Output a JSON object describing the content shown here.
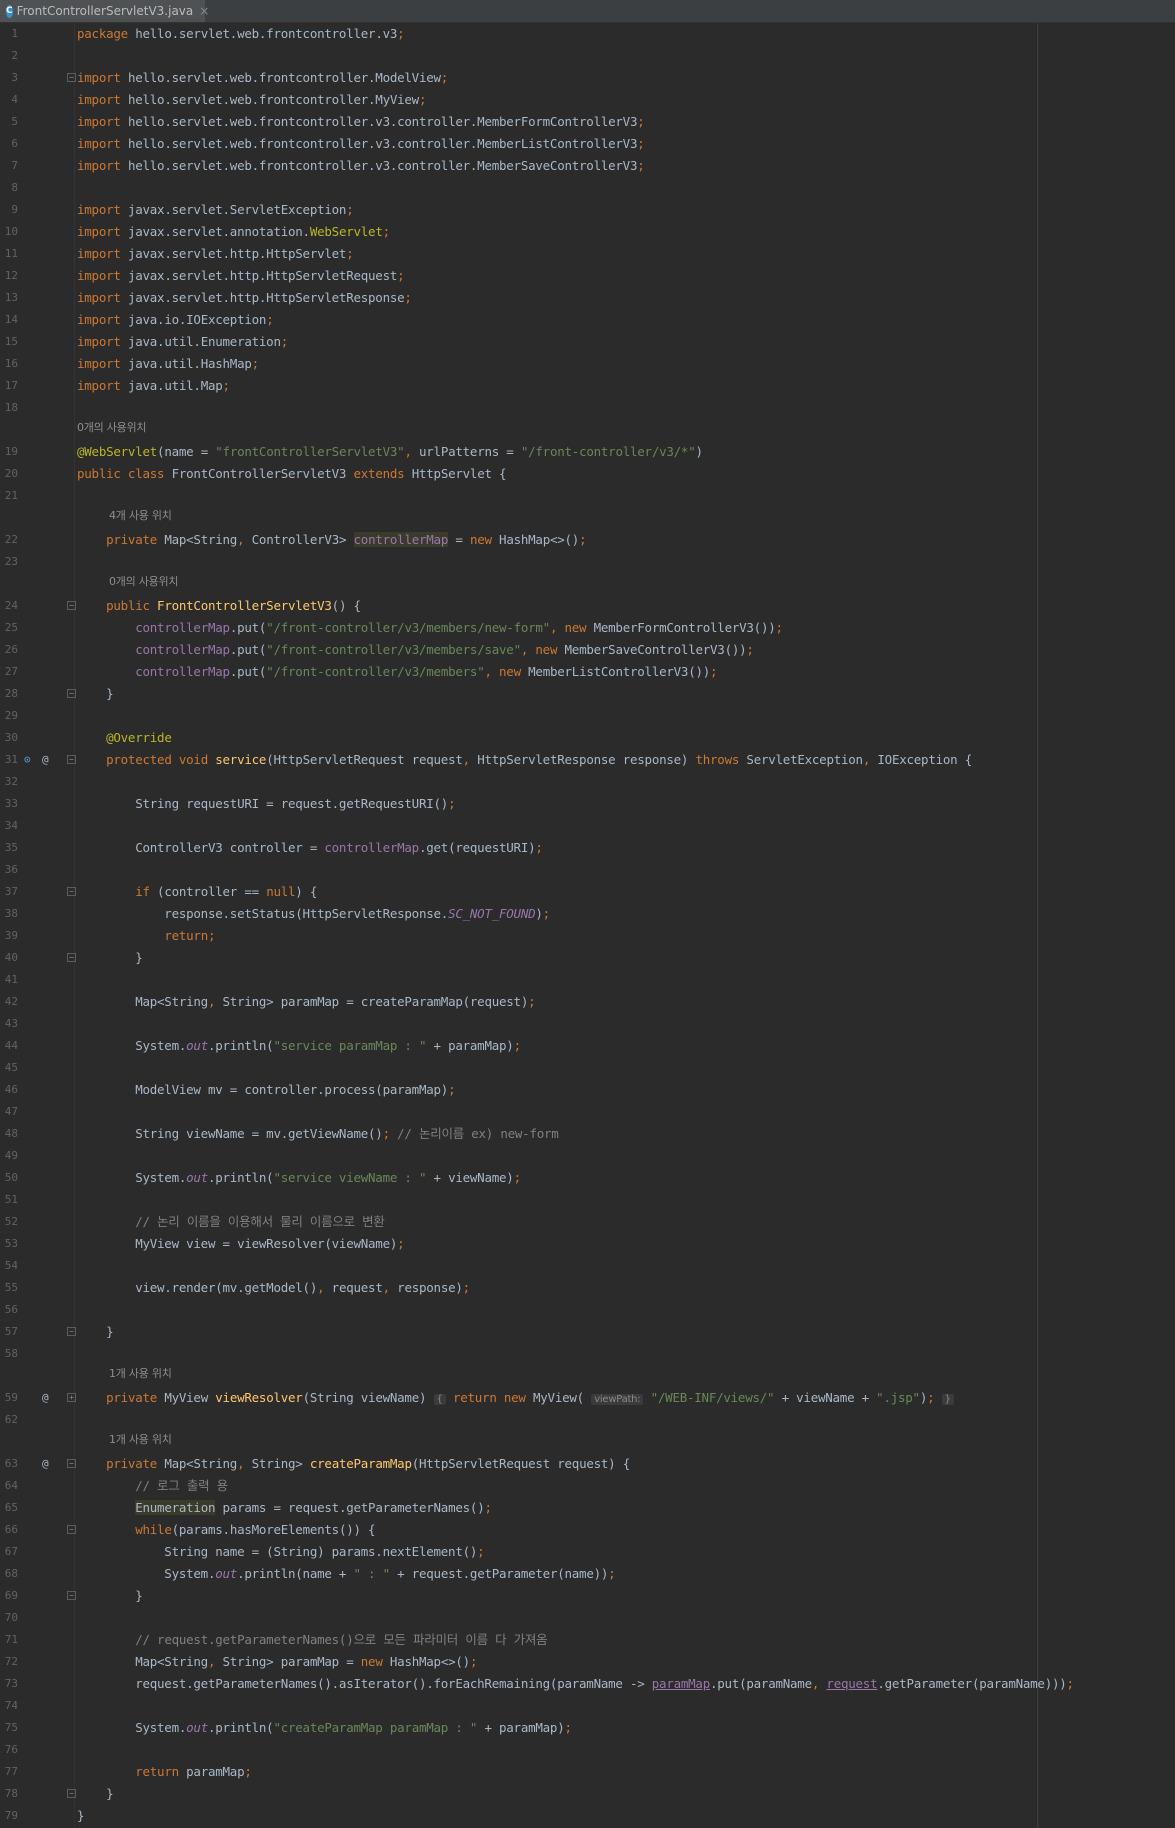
{
  "tab": {
    "label": "FrontControllerServletV3.java",
    "icon": "java-class-icon",
    "close": "×"
  },
  "lines": [
    {
      "n": "1",
      "tokens": [
        [
          "kw",
          "package "
        ],
        [
          "",
          "hello.servlet.web.frontcontroller.v3"
        ],
        [
          "kw",
          ";"
        ]
      ]
    },
    {
      "n": "2",
      "tokens": []
    },
    {
      "n": "3",
      "tokens": [
        [
          "kw",
          "import "
        ],
        [
          "",
          "hello.servlet.web.frontcontroller.ModelView"
        ],
        [
          "kw",
          ";"
        ]
      ]
    },
    {
      "n": "4",
      "tokens": [
        [
          "kw",
          "import "
        ],
        [
          "",
          "hello.servlet.web.frontcontroller.MyView"
        ],
        [
          "kw",
          ";"
        ]
      ]
    },
    {
      "n": "5",
      "tokens": [
        [
          "kw",
          "import "
        ],
        [
          "",
          "hello.servlet.web.frontcontroller.v3.controller.MemberFormControllerV3"
        ],
        [
          "kw",
          ";"
        ]
      ]
    },
    {
      "n": "6",
      "tokens": [
        [
          "kw",
          "import "
        ],
        [
          "",
          "hello.servlet.web.frontcontroller.v3.controller.MemberListControllerV3"
        ],
        [
          "kw",
          ";"
        ]
      ]
    },
    {
      "n": "7",
      "tokens": [
        [
          "kw",
          "import "
        ],
        [
          "",
          "hello.servlet.web.frontcontroller.v3.controller.MemberSaveControllerV3"
        ],
        [
          "kw",
          ";"
        ]
      ]
    },
    {
      "n": "8",
      "tokens": []
    },
    {
      "n": "9",
      "tokens": [
        [
          "kw",
          "import "
        ],
        [
          "",
          "javax.servlet.ServletException"
        ],
        [
          "kw",
          ";"
        ]
      ]
    },
    {
      "n": "10",
      "tokens": [
        [
          "kw",
          "import "
        ],
        [
          "",
          "javax.servlet.annotation."
        ],
        [
          "ann",
          "WebServlet"
        ],
        [
          "kw",
          ";"
        ]
      ]
    },
    {
      "n": "11",
      "tokens": [
        [
          "kw",
          "import "
        ],
        [
          "",
          "javax.servlet.http.HttpServlet"
        ],
        [
          "kw",
          ";"
        ]
      ]
    },
    {
      "n": "12",
      "tokens": [
        [
          "kw",
          "import "
        ],
        [
          "",
          "javax.servlet.http.HttpServletRequest"
        ],
        [
          "kw",
          ";"
        ]
      ]
    },
    {
      "n": "13",
      "tokens": [
        [
          "kw",
          "import "
        ],
        [
          "",
          "javax.servlet.http.HttpServletResponse"
        ],
        [
          "kw",
          ";"
        ]
      ]
    },
    {
      "n": "14",
      "tokens": [
        [
          "kw",
          "import "
        ],
        [
          "",
          "java.io.IOException"
        ],
        [
          "kw",
          ";"
        ]
      ]
    },
    {
      "n": "15",
      "tokens": [
        [
          "kw",
          "import "
        ],
        [
          "",
          "java.util.Enumeration"
        ],
        [
          "kw",
          ";"
        ]
      ]
    },
    {
      "n": "16",
      "tokens": [
        [
          "kw",
          "import "
        ],
        [
          "",
          "java.util.HashMap"
        ],
        [
          "kw",
          ";"
        ]
      ]
    },
    {
      "n": "17",
      "tokens": [
        [
          "kw",
          "import "
        ],
        [
          "",
          "java.util.Map"
        ],
        [
          "kw",
          ";"
        ]
      ]
    },
    {
      "n": "18",
      "tokens": []
    },
    {
      "n": "",
      "hint": "0개의 사용위치"
    },
    {
      "n": "19",
      "tokens": [
        [
          "ann",
          "@WebServlet"
        ],
        [
          "",
          "(name = "
        ],
        [
          "str",
          "\"frontControllerServletV3\""
        ],
        [
          "kw",
          ", "
        ],
        [
          "",
          "urlPatterns = "
        ],
        [
          "str",
          "\"/front-controller/v3/*\""
        ],
        [
          "",
          ")"
        ]
      ]
    },
    {
      "n": "20",
      "tokens": [
        [
          "kw",
          "public class "
        ],
        [
          "",
          "FrontControllerServletV3 "
        ],
        [
          "kw",
          "extends "
        ],
        [
          "",
          "HttpServlet {"
        ]
      ]
    },
    {
      "n": "21",
      "tokens": []
    },
    {
      "n": "",
      "hint": "4개 사용 위치",
      "indent": 1
    },
    {
      "n": "22",
      "tokens": [
        [
          "",
          "    "
        ],
        [
          "kw",
          "private "
        ],
        [
          "",
          "Map<String"
        ],
        [
          "kw",
          ", "
        ],
        [
          "",
          "ControllerV3> "
        ],
        [
          "fld hl",
          "controllerMap"
        ],
        [
          "",
          " = "
        ],
        [
          "kw",
          "new "
        ],
        [
          "",
          "HashMap<>()"
        ],
        [
          "kw",
          ";"
        ]
      ]
    },
    {
      "n": "23",
      "tokens": []
    },
    {
      "n": "",
      "hint": "0개의 사용위치",
      "indent": 1
    },
    {
      "n": "24",
      "tokens": [
        [
          "",
          "    "
        ],
        [
          "kw",
          "public "
        ],
        [
          "fn",
          "FrontControllerServletV3"
        ],
        [
          "",
          "() {"
        ]
      ]
    },
    {
      "n": "25",
      "tokens": [
        [
          "",
          "        "
        ],
        [
          "fld",
          "controllerMap"
        ],
        [
          "",
          ".put("
        ],
        [
          "str",
          "\"/front-controller/v3/members/new-form\""
        ],
        [
          "kw",
          ", new "
        ],
        [
          "",
          "MemberFormControllerV3())"
        ],
        [
          "kw",
          ";"
        ]
      ]
    },
    {
      "n": "26",
      "tokens": [
        [
          "",
          "        "
        ],
        [
          "fld",
          "controllerMap"
        ],
        [
          "",
          ".put("
        ],
        [
          "str",
          "\"/front-controller/v3/members/save\""
        ],
        [
          "kw",
          ", new "
        ],
        [
          "",
          "MemberSaveControllerV3())"
        ],
        [
          "kw",
          ";"
        ]
      ]
    },
    {
      "n": "27",
      "tokens": [
        [
          "",
          "        "
        ],
        [
          "fld",
          "controllerMap"
        ],
        [
          "",
          ".put("
        ],
        [
          "str",
          "\"/front-controller/v3/members\""
        ],
        [
          "kw",
          ", new "
        ],
        [
          "",
          "MemberListControllerV3())"
        ],
        [
          "kw",
          ";"
        ]
      ]
    },
    {
      "n": "28",
      "tokens": [
        [
          "",
          "    }"
        ]
      ]
    },
    {
      "n": "29",
      "tokens": []
    },
    {
      "n": "30",
      "tokens": [
        [
          "",
          "    "
        ],
        [
          "ann",
          "@Override"
        ]
      ]
    },
    {
      "n": "31",
      "tokens": [
        [
          "",
          "    "
        ],
        [
          "kw",
          "protected void "
        ],
        [
          "fn",
          "service"
        ],
        [
          "",
          "(HttpServletRequest request"
        ],
        [
          "kw",
          ", "
        ],
        [
          "",
          "HttpServletResponse response) "
        ],
        [
          "kw",
          "throws "
        ],
        [
          "",
          "ServletException"
        ],
        [
          "kw",
          ", "
        ],
        [
          "",
          "IOException {"
        ]
      ]
    },
    {
      "n": "32",
      "tokens": []
    },
    {
      "n": "33",
      "tokens": [
        [
          "",
          "        String requestURI = request.getRequestURI()"
        ],
        [
          "kw",
          ";"
        ]
      ]
    },
    {
      "n": "34",
      "tokens": []
    },
    {
      "n": "35",
      "tokens": [
        [
          "",
          "        ControllerV3 controller = "
        ],
        [
          "fld",
          "controllerMap"
        ],
        [
          "",
          ".get(requestURI)"
        ],
        [
          "kw",
          ";"
        ]
      ]
    },
    {
      "n": "36",
      "tokens": []
    },
    {
      "n": "37",
      "tokens": [
        [
          "",
          "        "
        ],
        [
          "kw",
          "if "
        ],
        [
          "",
          "(controller == "
        ],
        [
          "kw",
          "null"
        ],
        [
          "",
          ") {"
        ]
      ]
    },
    {
      "n": "38",
      "tokens": [
        [
          "",
          "            response.setStatus(HttpServletResponse."
        ],
        [
          "sf",
          "SC_NOT_FOUND"
        ],
        [
          "",
          ")"
        ],
        [
          "kw",
          ";"
        ]
      ]
    },
    {
      "n": "39",
      "tokens": [
        [
          "",
          "            "
        ],
        [
          "kw",
          "return;"
        ]
      ]
    },
    {
      "n": "40",
      "tokens": [
        [
          "",
          "        }"
        ]
      ]
    },
    {
      "n": "41",
      "tokens": []
    },
    {
      "n": "42",
      "tokens": [
        [
          "",
          "        Map<String"
        ],
        [
          "kw",
          ", "
        ],
        [
          "",
          "String> paramMap = createParamMap(request)"
        ],
        [
          "kw",
          ";"
        ]
      ]
    },
    {
      "n": "43",
      "tokens": []
    },
    {
      "n": "44",
      "tokens": [
        [
          "",
          "        System."
        ],
        [
          "sf",
          "out"
        ],
        [
          "",
          ".println("
        ],
        [
          "str",
          "\"service paramMap : \""
        ],
        [
          "",
          " + paramMap)"
        ],
        [
          "kw",
          ";"
        ]
      ]
    },
    {
      "n": "45",
      "tokens": []
    },
    {
      "n": "46",
      "tokens": [
        [
          "",
          "        ModelView mv = controller.process(paramMap)"
        ],
        [
          "kw",
          ";"
        ]
      ]
    },
    {
      "n": "47",
      "tokens": []
    },
    {
      "n": "48",
      "tokens": [
        [
          "",
          "        String viewName = mv.getViewName()"
        ],
        [
          "kw",
          "; "
        ],
        [
          "cmt",
          "// 논리이름 ex) new-form"
        ]
      ]
    },
    {
      "n": "49",
      "tokens": []
    },
    {
      "n": "50",
      "tokens": [
        [
          "",
          "        System."
        ],
        [
          "sf",
          "out"
        ],
        [
          "",
          ".println("
        ],
        [
          "str",
          "\"service viewName : \""
        ],
        [
          "",
          " + viewName)"
        ],
        [
          "kw",
          ";"
        ]
      ]
    },
    {
      "n": "51",
      "tokens": []
    },
    {
      "n": "52",
      "tokens": [
        [
          "",
          "        "
        ],
        [
          "cmt",
          "// 논리 이름을 이용해서 물리 이름으로 변환"
        ]
      ]
    },
    {
      "n": "53",
      "tokens": [
        [
          "",
          "        MyView view = viewResolver(viewName)"
        ],
        [
          "kw",
          ";"
        ]
      ]
    },
    {
      "n": "54",
      "tokens": []
    },
    {
      "n": "55",
      "tokens": [
        [
          "",
          "        view.render(mv.getModel()"
        ],
        [
          "kw",
          ", "
        ],
        [
          "",
          "request"
        ],
        [
          "kw",
          ", "
        ],
        [
          "",
          "response)"
        ],
        [
          "kw",
          ";"
        ]
      ]
    },
    {
      "n": "56",
      "tokens": []
    },
    {
      "n": "57",
      "tokens": [
        [
          "",
          "    }"
        ]
      ]
    },
    {
      "n": "58",
      "tokens": []
    },
    {
      "n": "",
      "hint": "1개 사용 위치",
      "indent": 1
    },
    {
      "n": "59",
      "tokens": [
        [
          "",
          "    "
        ],
        [
          "kw",
          "private "
        ],
        [
          "",
          "MyView "
        ],
        [
          "fn",
          "viewResolver"
        ],
        [
          "",
          "(String viewName) "
        ],
        [
          "inlay-b",
          "{"
        ],
        [
          "",
          " "
        ],
        [
          "kw",
          "return new "
        ],
        [
          "",
          "MyView( "
        ],
        [
          "inlay",
          "viewPath:"
        ],
        [
          "",
          " "
        ],
        [
          "str",
          "\"/WEB-INF/views/\""
        ],
        [
          "",
          " + viewName + "
        ],
        [
          "str",
          "\".jsp\""
        ],
        [
          "",
          ")"
        ],
        [
          "kw",
          ";"
        ],
        [
          "",
          " "
        ],
        [
          "inlay-b",
          "}"
        ]
      ]
    },
    {
      "n": "62",
      "tokens": []
    },
    {
      "n": "",
      "hint": "1개 사용 위치",
      "indent": 1
    },
    {
      "n": "63",
      "tokens": [
        [
          "",
          "    "
        ],
        [
          "kw",
          "private "
        ],
        [
          "",
          "Map<String"
        ],
        [
          "kw",
          ", "
        ],
        [
          "",
          "String> "
        ],
        [
          "fn",
          "createParamMap"
        ],
        [
          "",
          "(HttpServletRequest request) {"
        ]
      ]
    },
    {
      "n": "64",
      "tokens": [
        [
          "",
          "        "
        ],
        [
          "cmt",
          "// 로그 출력 용"
        ]
      ]
    },
    {
      "n": "65",
      "tokens": [
        [
          "",
          "        "
        ],
        [
          "hl",
          "Enumeration"
        ],
        [
          "",
          " params = request.getParameterNames()"
        ],
        [
          "kw",
          ";"
        ]
      ]
    },
    {
      "n": "66",
      "tokens": [
        [
          "",
          "        "
        ],
        [
          "kw",
          "while"
        ],
        [
          "",
          "(params.hasMoreElements()) {"
        ]
      ]
    },
    {
      "n": "67",
      "tokens": [
        [
          "",
          "            String name = (String) params.nextElement()"
        ],
        [
          "kw",
          ";"
        ]
      ]
    },
    {
      "n": "68",
      "tokens": [
        [
          "",
          "            System."
        ],
        [
          "sf",
          "out"
        ],
        [
          "",
          ".println(name + "
        ],
        [
          "str",
          "\" : \""
        ],
        [
          "",
          " + request.getParameter(name))"
        ],
        [
          "kw",
          ";"
        ]
      ]
    },
    {
      "n": "69",
      "tokens": [
        [
          "",
          "        }"
        ]
      ]
    },
    {
      "n": "70",
      "tokens": []
    },
    {
      "n": "71",
      "tokens": [
        [
          "",
          "        "
        ],
        [
          "cmt",
          "// request.getParameterNames()으로 모든 파라미터 이름 다 가져옴"
        ]
      ]
    },
    {
      "n": "72",
      "tokens": [
        [
          "",
          "        Map<String"
        ],
        [
          "kw",
          ", "
        ],
        [
          "",
          "String> paramMap = "
        ],
        [
          "kw",
          "new "
        ],
        [
          "",
          "HashMap<>()"
        ],
        [
          "kw",
          ";"
        ]
      ]
    },
    {
      "n": "73",
      "tokens": [
        [
          "",
          "        request.getParameterNames().asIterator().forEachRemaining(paramName -> "
        ],
        [
          "und",
          "paramMap"
        ],
        [
          "",
          ".put(paramName"
        ],
        [
          "kw",
          ", "
        ],
        [
          "und",
          "request"
        ],
        [
          "",
          ".getParameter(paramName)))"
        ],
        [
          "kw",
          ";"
        ]
      ]
    },
    {
      "n": "74",
      "tokens": []
    },
    {
      "n": "75",
      "tokens": [
        [
          "",
          "        System."
        ],
        [
          "sf",
          "out"
        ],
        [
          "",
          ".println("
        ],
        [
          "str",
          "\"createParamMap paramMap : \""
        ],
        [
          "",
          " + paramMap)"
        ],
        [
          "kw",
          ";"
        ]
      ]
    },
    {
      "n": "76",
      "tokens": []
    },
    {
      "n": "77",
      "tokens": [
        [
          "",
          "        "
        ],
        [
          "kw",
          "return "
        ],
        [
          "",
          "paramMap"
        ],
        [
          "kw",
          ";"
        ]
      ]
    },
    {
      "n": "78",
      "tokens": [
        [
          "",
          "    }"
        ]
      ]
    },
    {
      "n": "79",
      "tokens": [
        [
          "",
          "}"
        ]
      ]
    }
  ],
  "gutter": {
    "line31": [
      "override-icon",
      "at-icon"
    ],
    "line59": [
      "at-icon"
    ],
    "line63": [
      "at-icon"
    ]
  },
  "colors": {
    "background": "#2b2b2b",
    "keyword": "#cc7832",
    "string": "#6a8759",
    "annotation": "#bbb529",
    "method": "#ffc66d",
    "field": "#9876aa",
    "comment": "#808080",
    "text": "#a9b7c6"
  }
}
